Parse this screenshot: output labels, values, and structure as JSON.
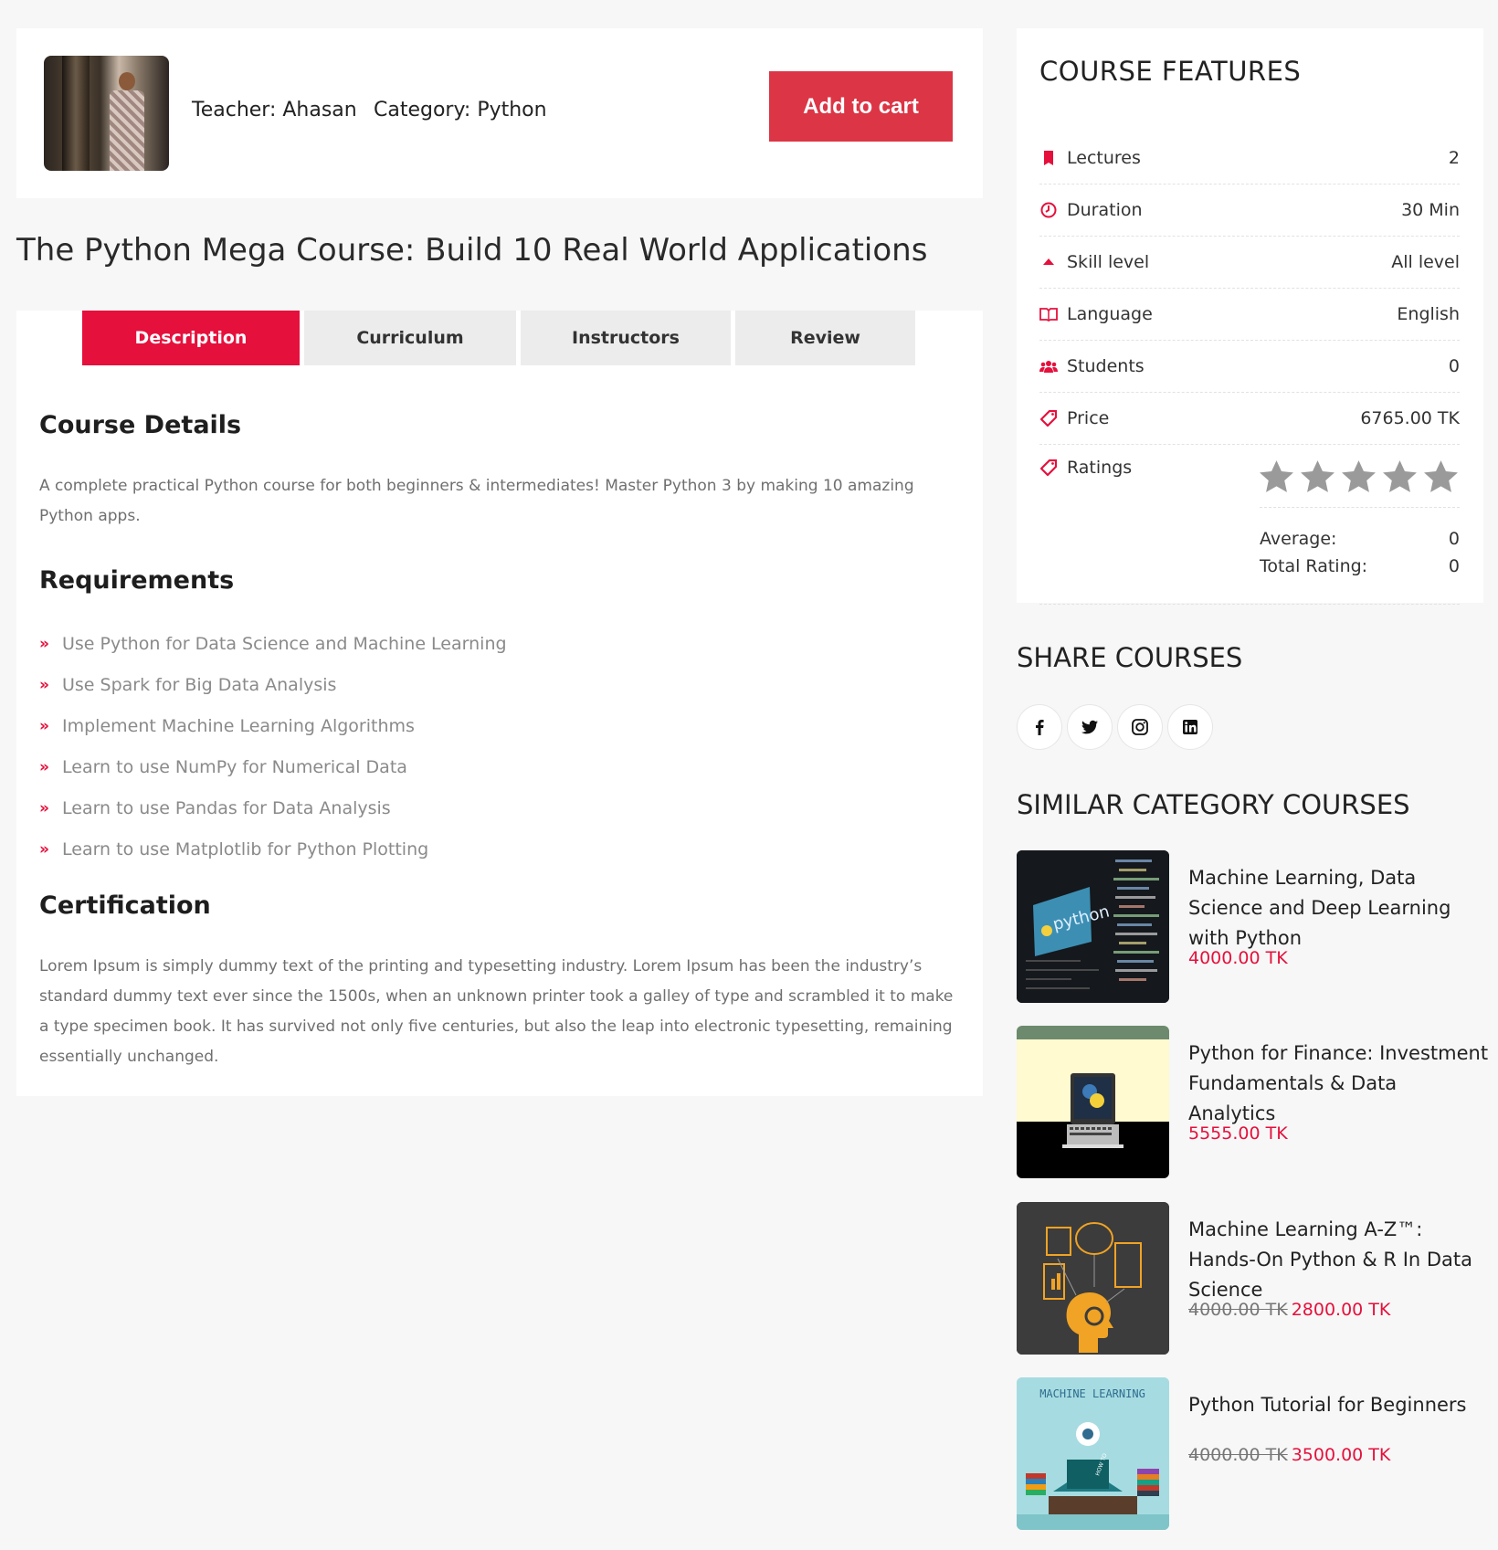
{
  "header": {
    "teacher_label": "Teacher:",
    "teacher_name": "Ahasan",
    "category_label": "Category:",
    "category_name": "Python",
    "add_to_cart": "Add to cart"
  },
  "course": {
    "title": "The Python Mega Course: Build 10 Real World Applications"
  },
  "tabs": [
    {
      "label": "Description",
      "active": true
    },
    {
      "label": "Curriculum",
      "active": false
    },
    {
      "label": "Instructors",
      "active": false
    },
    {
      "label": "Review",
      "active": false
    }
  ],
  "description": {
    "details_heading": "Course Details",
    "details_text": "A complete practical Python course for both beginners & intermediates! Master Python 3 by making 10 amazing Python apps.",
    "requirements_heading": "Requirements",
    "requirements": [
      "Use Python for Data Science and Machine Learning",
      "Use Spark for Big Data Analysis",
      "Implement Machine Learning Algorithms",
      "Learn to use NumPy for Numerical Data",
      "Learn to use Pandas for Data Analysis",
      "Learn to use Matplotlib for Python Plotting"
    ],
    "certification_heading": "Certification",
    "certification_text": "Lorem Ipsum is simply dummy text of the printing and typesetting industry. Lorem Ipsum has been the industry’s standard dummy text ever since the 1500s, when an unknown printer took a galley of type and scrambled it to make a type specimen book. It has survived not only five centuries, but also the leap into electronic typesetting, remaining essentially unchanged."
  },
  "features": {
    "title": "COURSE FEATURES",
    "rows": [
      {
        "icon": "bookmark-icon",
        "label": "Lectures",
        "value": "2"
      },
      {
        "icon": "clock-icon",
        "label": "Duration",
        "value": "30 Min"
      },
      {
        "icon": "level-up-icon",
        "label": "Skill level",
        "value": "All level"
      },
      {
        "icon": "language-book-icon",
        "label": "Language",
        "value": "English"
      },
      {
        "icon": "users-icon",
        "label": "Students",
        "value": "0"
      },
      {
        "icon": "price-tag-icon",
        "label": "Price",
        "value": "6765.00 TK"
      }
    ],
    "ratings": {
      "label": "Ratings",
      "stars_filled": 0,
      "stars_total": 5,
      "average_label": "Average:",
      "average_value": "0",
      "total_label": "Total Rating:",
      "total_value": "0"
    }
  },
  "share": {
    "title": "SHARE COURSES",
    "icons": [
      "facebook-icon",
      "twitter-icon",
      "instagram-icon",
      "linkedin-icon"
    ]
  },
  "similar": {
    "title": "SIMILAR CATEGORY COURSES",
    "items": [
      {
        "name": "Machine Learning, Data Science and Deep Learning with Python",
        "old_price": "",
        "price": "4000.00 TK"
      },
      {
        "name": "Python for Finance: Investment Fundamentals & Data Analytics",
        "old_price": "",
        "price": "5555.00 TK"
      },
      {
        "name": "Machine Learning A-Z™: Hands-On Python & R In Data Science",
        "old_price": "4000.00 TK",
        "price": "2800.00 TK"
      },
      {
        "name": "Python Tutorial for Beginners",
        "old_price": "4000.00 TK",
        "price": "3500.00 TK"
      }
    ],
    "thumb_texts": {
      "python_logo_text": "python",
      "ml_book_text": "MACHINE LEARNING",
      "how_to_text": "HOW TO"
    }
  },
  "colors": {
    "accent": "#e5103c",
    "cart_button": "#dc3545"
  }
}
